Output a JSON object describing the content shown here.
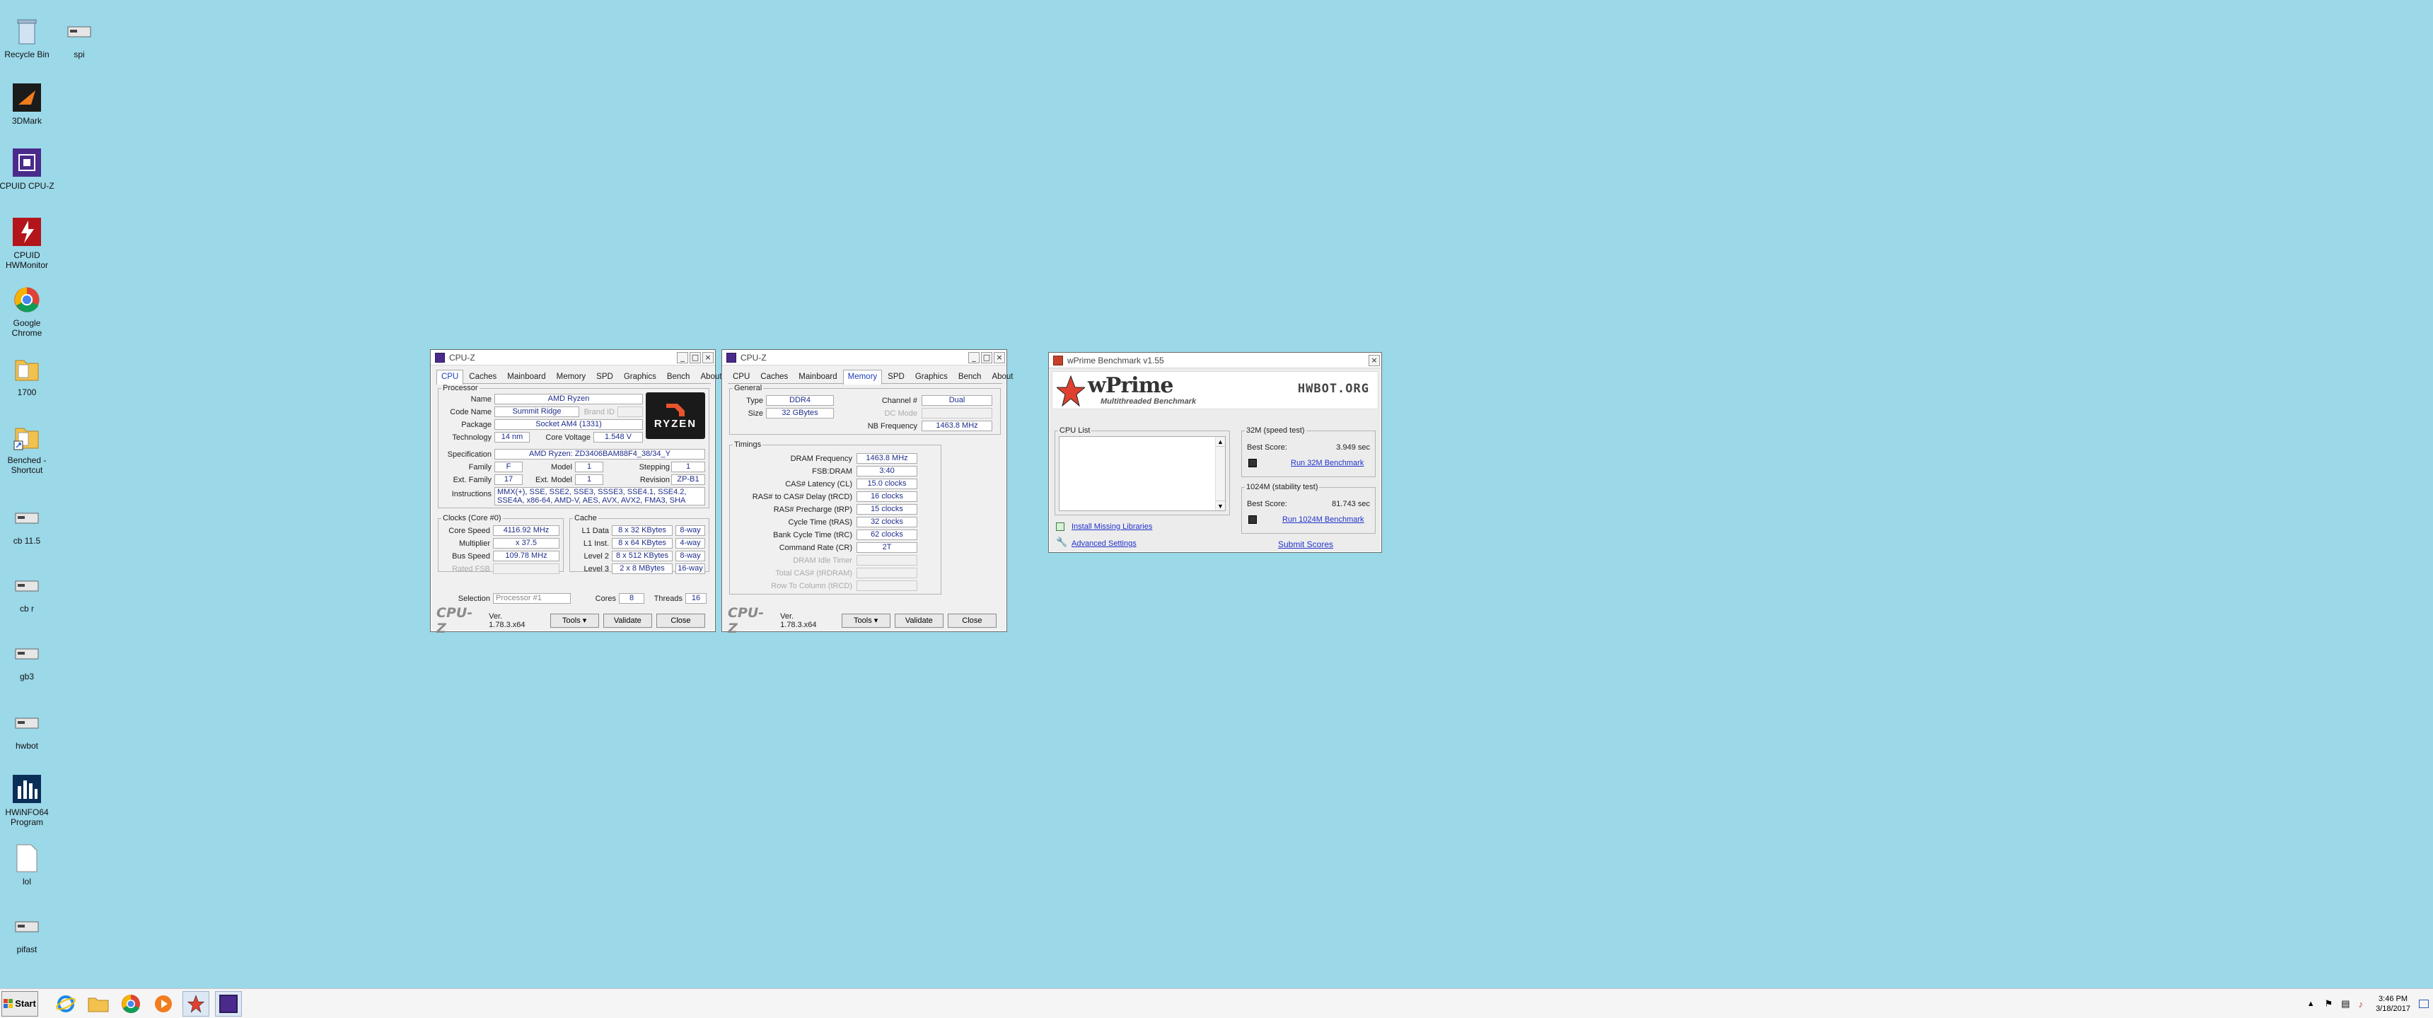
{
  "desktop": {
    "icons": [
      {
        "label": "Recycle Bin",
        "icon": "recycle-bin-icon"
      },
      {
        "label": "spi",
        "icon": "drive-icon"
      },
      {
        "label": "3DMark",
        "icon": "3dmark-icon"
      },
      {
        "label": "CPUID CPU-Z",
        "icon": "cpuz-icon"
      },
      {
        "label": "CPUID HWMonitor",
        "icon": "hwmonitor-icon"
      },
      {
        "label": "Google Chrome",
        "icon": "chrome-icon"
      },
      {
        "label": "1700",
        "icon": "folder-icon"
      },
      {
        "label": "Benched - Shortcut",
        "icon": "shortcut-folder-icon"
      },
      {
        "label": "cb 11.5",
        "icon": "drive-icon"
      },
      {
        "label": "cb r",
        "icon": "drive-icon"
      },
      {
        "label": "gb3",
        "icon": "drive-icon"
      },
      {
        "label": "hwbot",
        "icon": "drive-icon"
      },
      {
        "label": "HWiNFO64 Program",
        "icon": "hwinfo-icon"
      },
      {
        "label": "lol",
        "icon": "document-icon"
      },
      {
        "label": "pifast",
        "icon": "drive-icon"
      }
    ]
  },
  "cpuz_cpu": {
    "title": "CPU-Z",
    "tabs": [
      "CPU",
      "Caches",
      "Mainboard",
      "Memory",
      "SPD",
      "Graphics",
      "Bench",
      "About"
    ],
    "processor_legend": "Processor",
    "name_label": "Name",
    "name": "AMD Ryzen",
    "codename_label": "Code Name",
    "codename": "Summit Ridge",
    "brandid_label": "Brand ID",
    "package_label": "Package",
    "package": "Socket AM4 (1331)",
    "technology_label": "Technology",
    "technology": "14 nm",
    "corevoltage_label": "Core Voltage",
    "corevoltage": "1.548 V",
    "spec_label": "Specification",
    "spec": "AMD Ryzen: ZD3406BAM88F4_38/34_Y",
    "family_label": "Family",
    "family": "F",
    "model_label": "Model",
    "model": "1",
    "stepping_label": "Stepping",
    "stepping": "1",
    "extfamily_label": "Ext. Family",
    "extfamily": "17",
    "extmodel_label": "Ext. Model",
    "extmodel": "1",
    "revision_label": "Revision",
    "revision": "ZP-B1",
    "instructions_label": "Instructions",
    "instructions": "MMX(+), SSE, SSE2, SSE3, SSSE3, SSE4.1, SSE4.2, SSE4A, x86-64, AMD-V, AES, AVX, AVX2, FMA3, SHA",
    "logo_text": "RYZEN",
    "clocks_legend": "Clocks (Core #0)",
    "corespeed_label": "Core Speed",
    "corespeed": "4116.92 MHz",
    "multiplier_label": "Multiplier",
    "multiplier": "x 37.5",
    "busspeed_label": "Bus Speed",
    "busspeed": "109.78 MHz",
    "ratedfsb_label": "Rated FSB",
    "cache_legend": "Cache",
    "cache": [
      {
        "label": "L1 Data",
        "size": "8 x 32 KBytes",
        "way": "8-way"
      },
      {
        "label": "L1 Inst.",
        "size": "8 x 64 KBytes",
        "way": "4-way"
      },
      {
        "label": "Level 2",
        "size": "8 x 512 KBytes",
        "way": "8-way"
      },
      {
        "label": "Level 3",
        "size": "2 x 8 MBytes",
        "way": "16-way"
      }
    ],
    "selection_label": "Selection",
    "selection": "Processor #1",
    "cores_label": "Cores",
    "cores": "8",
    "threads_label": "Threads",
    "threads": "16",
    "brand": "CPU-Z",
    "version": "Ver. 1.78.3.x64",
    "tools": "Tools",
    "validate": "Validate",
    "close": "Close"
  },
  "cpuz_mem": {
    "title": "CPU-Z",
    "tabs": [
      "CPU",
      "Caches",
      "Mainboard",
      "Memory",
      "SPD",
      "Graphics",
      "Bench",
      "About"
    ],
    "general_legend": "General",
    "type_label": "Type",
    "type": "DDR4",
    "size_label": "Size",
    "size": "32 GBytes",
    "channel_label": "Channel #",
    "channel": "Dual",
    "dcmode_label": "DC Mode",
    "nbfreq_label": "NB Frequency",
    "nbfreq": "1463.8 MHz",
    "timings_legend": "Timings",
    "timings": [
      {
        "label": "DRAM Frequency",
        "value": "1463.8 MHz",
        "dim": false
      },
      {
        "label": "FSB:DRAM",
        "value": "3:40",
        "dim": false
      },
      {
        "label": "CAS# Latency (CL)",
        "value": "15.0 clocks",
        "dim": false
      },
      {
        "label": "RAS# to CAS# Delay (tRCD)",
        "value": "16 clocks",
        "dim": false
      },
      {
        "label": "RAS# Precharge (tRP)",
        "value": "15 clocks",
        "dim": false
      },
      {
        "label": "Cycle Time (tRAS)",
        "value": "32 clocks",
        "dim": false
      },
      {
        "label": "Bank Cycle Time (tRC)",
        "value": "62 clocks",
        "dim": false
      },
      {
        "label": "Command Rate (CR)",
        "value": "2T",
        "dim": false
      },
      {
        "label": "DRAM Idle Timer",
        "value": "",
        "dim": true
      },
      {
        "label": "Total CAS# (tRDRAM)",
        "value": "",
        "dim": true
      },
      {
        "label": "Row To Column (tRCD)",
        "value": "",
        "dim": true
      }
    ],
    "brand": "CPU-Z",
    "version": "Ver. 1.78.3.x64",
    "tools": "Tools",
    "validate": "Validate",
    "close": "Close"
  },
  "wprime": {
    "title": "wPrime Benchmark v1.55",
    "logo": "wPrime",
    "tagline": "Multithreaded Benchmark",
    "hwbot": "HWBOT.ORG",
    "cpulist_legend": "CPU List",
    "s32_legend": "32M (speed test)",
    "s32_best_label": "Best Score:",
    "s32_best": "3.949 sec",
    "s32_run": "Run 32M Benchmark",
    "s1024_legend": "1024M (stability test)",
    "s1024_best_label": "Best Score:",
    "s1024_best": "81.743 sec",
    "s1024_run": "Run 1024M Benchmark",
    "install_libs": "Install Missing Libraries",
    "advanced": "Advanced Settings",
    "submit": "Submit Scores"
  },
  "taskbar": {
    "start": "Start",
    "time": "3:46 PM",
    "date": "3/18/2017"
  },
  "colors": {
    "desktop": "#9bd8e8",
    "value_text": "#1f2d8a",
    "link": "#2233cc"
  }
}
